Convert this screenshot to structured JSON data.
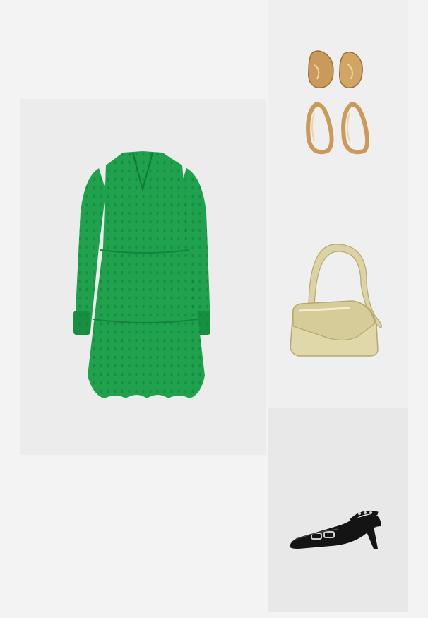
{
  "outfit": {
    "items": [
      {
        "icon": "green-eyelet-dress-image",
        "color": "#1fa14e"
      },
      {
        "icon": "gold-earrings-image",
        "color": "#c89a5a"
      },
      {
        "icon": "gold-shoulder-bag-image",
        "color": "#d8cf9c"
      },
      {
        "icon": "black-slingback-heel-image",
        "color": "#111111"
      }
    ]
  }
}
